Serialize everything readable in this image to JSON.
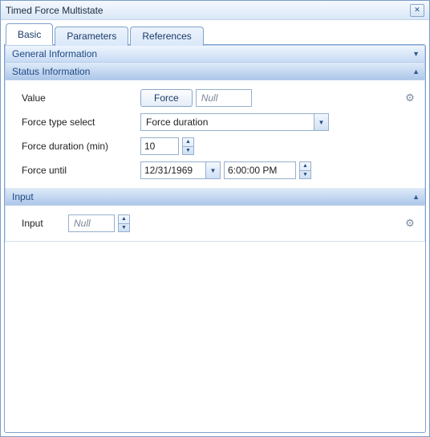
{
  "window": {
    "title": "Timed Force Multistate"
  },
  "tabs": {
    "basic": "Basic",
    "parameters": "Parameters",
    "references": "References"
  },
  "sections": {
    "general": "General Information",
    "status": "Status Information",
    "input": "Input"
  },
  "fields": {
    "value_label": "Value",
    "force_button": "Force",
    "value_text": "Null",
    "force_type_label": "Force type select",
    "force_type_value": "Force duration",
    "force_duration_label": "Force duration (min)",
    "force_duration_value": "10",
    "force_until_label": "Force until",
    "force_until_date": "12/31/1969",
    "force_until_time": "6:00:00  PM",
    "input_label": "Input",
    "input_value": "Null"
  },
  "icons": {
    "chev_collapsed": "▼",
    "chev_expanded": "▲",
    "combo_arrow": "▼",
    "spin_up": "▲",
    "spin_down": "▼",
    "gear": "⚙",
    "close": "✕"
  }
}
